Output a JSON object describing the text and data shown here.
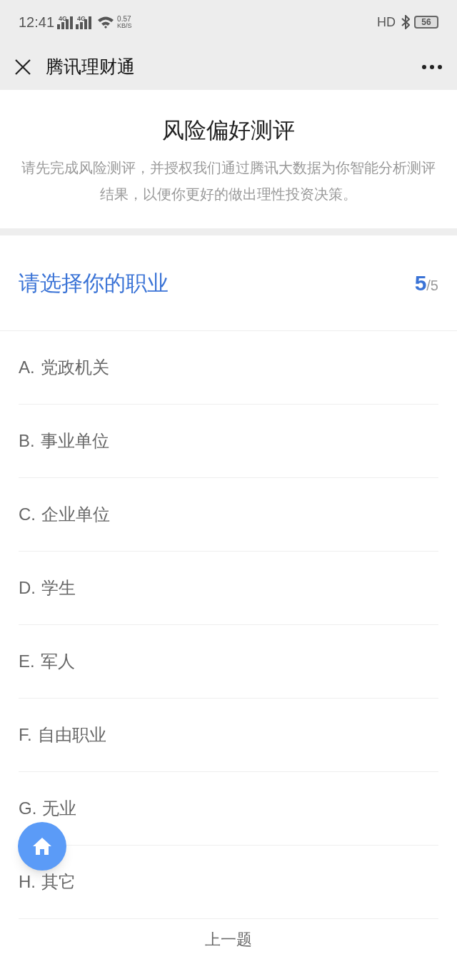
{
  "status_bar": {
    "time": "12:41",
    "networks": [
      "4G",
      "4G"
    ],
    "speed": "0.57",
    "speed_unit": "KB/S",
    "hd": "HD",
    "battery": "56"
  },
  "nav": {
    "title": "腾讯理财通"
  },
  "header": {
    "title": "风险偏好测评",
    "description": "请先完成风险测评，并授权我们通过腾讯大数据为你智能分析测评结果，以便你更好的做出理性投资决策。"
  },
  "question": {
    "title": "请选择你的职业",
    "current": "5",
    "total": "/5"
  },
  "options": [
    {
      "letter": "A.",
      "label": "党政机关",
      "selected": false
    },
    {
      "letter": "B.",
      "label": "事业单位",
      "selected": false
    },
    {
      "letter": "C.",
      "label": "企业单位",
      "selected": false
    },
    {
      "letter": "D.",
      "label": "学生",
      "selected": false
    },
    {
      "letter": "E.",
      "label": "军人",
      "selected": false
    },
    {
      "letter": "F.",
      "label": "自由职业",
      "selected": false
    },
    {
      "letter": "G.",
      "label": "无业",
      "selected": false
    },
    {
      "letter": "H.",
      "label": "其它",
      "selected": false
    }
  ],
  "previous_button": "上一题"
}
